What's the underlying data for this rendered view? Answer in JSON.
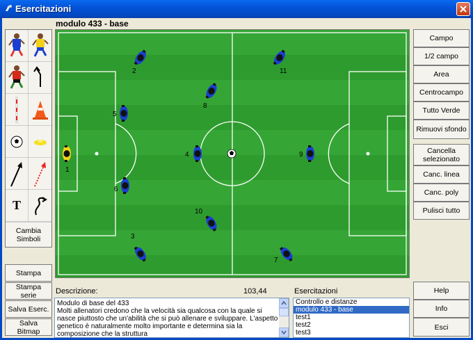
{
  "window": {
    "title": "Esercitazioni"
  },
  "module_title": "modulo 433 - base",
  "right_buttons": [
    {
      "label": "Campo"
    },
    {
      "label": "1/2 campo"
    },
    {
      "label": "Area"
    },
    {
      "label": "Centrocampo"
    },
    {
      "label": "Tutto Verde"
    },
    {
      "label": "Rimuovi sfondo"
    }
  ],
  "right_buttons2": [
    {
      "label": "Cancella selezionato"
    },
    {
      "label": "Canc. linea"
    },
    {
      "label": "Canc. poly"
    },
    {
      "label": "Pulisci tutto"
    }
  ],
  "right_buttons3": [
    {
      "label": "Help"
    },
    {
      "label": "Info"
    },
    {
      "label": "Esci"
    }
  ],
  "left_tools": {
    "text_tool": "T",
    "cambia_simboli": "Cambia Simboli"
  },
  "left_buttons": [
    {
      "label": "Stampa"
    },
    {
      "label": "Stampa serie"
    },
    {
      "label": "Salva Eserc."
    },
    {
      "label": "Salva Bitmap"
    }
  ],
  "description": {
    "label": "Descrizione:",
    "value": "103,44",
    "text": "Modulo di base del 433\nMolti allenatori credono che la velocità sia qualcosa con la quale si nasce piuttosto che un'abilità che si può allenare e sviluppare. L'aspetto genetico è naturalmente molto importante e determina sia la composizione che la struttura"
  },
  "exercises": {
    "label": "Esercitazioni",
    "items": [
      "Controllo e distanze",
      "modulo 433 - base",
      "test1",
      "test2",
      "test3"
    ],
    "selected": 1
  },
  "players": [
    {
      "number": "1",
      "color": "yellow"
    },
    {
      "number": "2",
      "color": "blue"
    },
    {
      "number": "3",
      "color": "blue"
    },
    {
      "number": "4",
      "color": "blue"
    },
    {
      "number": "5",
      "color": "blue"
    },
    {
      "number": "6",
      "color": "blue"
    },
    {
      "number": "7",
      "color": "blue"
    },
    {
      "number": "8",
      "color": "blue"
    },
    {
      "number": "9",
      "color": "blue"
    },
    {
      "number": "10",
      "color": "blue"
    },
    {
      "number": "11",
      "color": "blue"
    }
  ],
  "colors": {
    "pitch_dark": "#2E9B2E",
    "pitch_light": "#3DB13D",
    "lines": "#FFFFFF",
    "selection": "#316AC5",
    "titlebar": "#0553D8"
  }
}
